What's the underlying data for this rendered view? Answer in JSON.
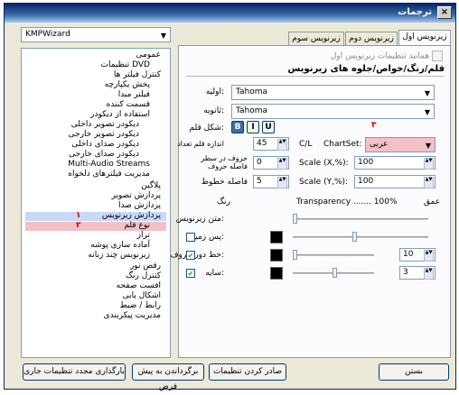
{
  "window": {
    "title": "ترجمات",
    "close": "×"
  },
  "sidebar": {
    "preset": "KMPWizard",
    "tree": [
      "عمومی",
      "تنظیمات DVD",
      "کنترل فیلتر ها",
      "پخش یکپارچه",
      "فیلتر مبدا",
      "قسمت کننده",
      "استفاده از دیکودر",
      "دیکودر تصویر داخلی",
      "دیکودر تصویر خارجی",
      "دیکودر صدای داخلی",
      "دیکودر صدای خارجی",
      "Multi-Audio Streams",
      "مدیریت فیلترهای دلخواه",
      "پلاگین",
      "پردازش تصویر",
      "پردازش صدا",
      "پردازش زیرنویس",
      "نوع قلم",
      "تراز",
      "آماده سازی پوشه",
      "زیرنویس چند زبانه",
      "رقص نور",
      "کنترل رنگ",
      "افست صفحه",
      "اشکال یابی",
      "رابط / ضبط",
      "مدیریت پیکربندی"
    ]
  },
  "annotations": {
    "one": "۱",
    "two": "۲",
    "three": "۳"
  },
  "tabs": [
    "زیرنویس اول",
    "زیرنویس دوم",
    "زیرنویس سوم"
  ],
  "settings": {
    "same_as_first": "همانند تنظیمات زیرنویس اول",
    "heading": "قلم/رنگ/خواص/جلوه های زیرنویس",
    "primary_label": "اولیه:",
    "primary_font": "Tahoma",
    "secondary_label": "ثانویه:",
    "secondary_font": "Tahoma",
    "font_style_label": "شکل قلم:",
    "bold": "B",
    "italic": "I",
    "underline": "U",
    "charset_label": "ChartSet:",
    "charset_value": "عربی",
    "size_label": "اندازه قلم تعداد",
    "size_value": "45",
    "cl_label": "C/L",
    "line_spacing_label": "حروف در سطر فاصله حروف",
    "line_spacing_value": "0",
    "scale_x_label": "Scale (X,%):",
    "scale_x_value": "100",
    "line_gap_label": "فاصله خطوط",
    "line_gap_value": "5",
    "scale_y_label": "Scale (Y,%):",
    "scale_y_value": "100",
    "depth_label": "عمق",
    "transparency_label": "Transparency ....... 100%",
    "color_label": "رنگ",
    "text_label": "متن زیرنویس:",
    "background_label": "پس زمینه:",
    "outline_label": "خط دور حروف:",
    "outline_value": "10",
    "shadow_label": "سایه:",
    "shadow_value": "3"
  },
  "footer": {
    "reload": "بارگذاری مجدد تنظیمات جاری",
    "reset": "برگرداندن به پیش فرض",
    "export": "صادر کردن تنظیمات",
    "close": "بستن"
  },
  "colors": {
    "accent": "#d40000",
    "highlight": "#c8d8f8",
    "charset_bg": "#f3c0c8"
  }
}
